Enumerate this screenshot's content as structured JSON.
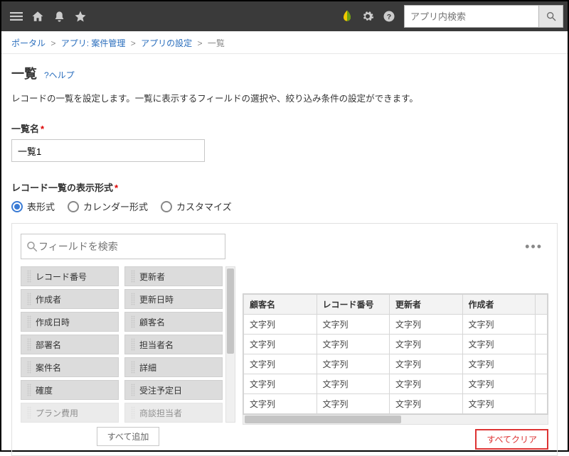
{
  "topbar": {
    "search_placeholder": "アプリ内検索"
  },
  "breadcrumb": {
    "portal": "ポータル",
    "app": "アプリ: 案件管理",
    "settings": "アプリの設定",
    "current": "一覧"
  },
  "page": {
    "heading": "一覧",
    "help": "?ヘルプ",
    "description": "レコードの一覧を設定します。一覧に表示するフィールドの選択や、絞り込み条件の設定ができます。",
    "name_label": "一覧名",
    "name_value": "一覧1",
    "display_label": "レコード一覧の表示形式",
    "radio_table": "表形式",
    "radio_calendar": "カレンダー形式",
    "radio_custom": "カスタマイズ"
  },
  "picker": {
    "search_placeholder": "フィールドを検索",
    "col1": [
      "レコード番号",
      "作成者",
      "作成日時",
      "部署名",
      "案件名",
      "確度",
      "プラン費用"
    ],
    "col2": [
      "更新者",
      "更新日時",
      "顧客名",
      "担当者名",
      "詳細",
      "受注予定日",
      "商談担当者"
    ],
    "add_all": "すべて追加"
  },
  "table": {
    "headers": [
      "顧客名",
      "レコード番号",
      "更新者",
      "作成者"
    ],
    "cell": "文字列",
    "rows": 5,
    "clear_all": "すべてクリア"
  }
}
